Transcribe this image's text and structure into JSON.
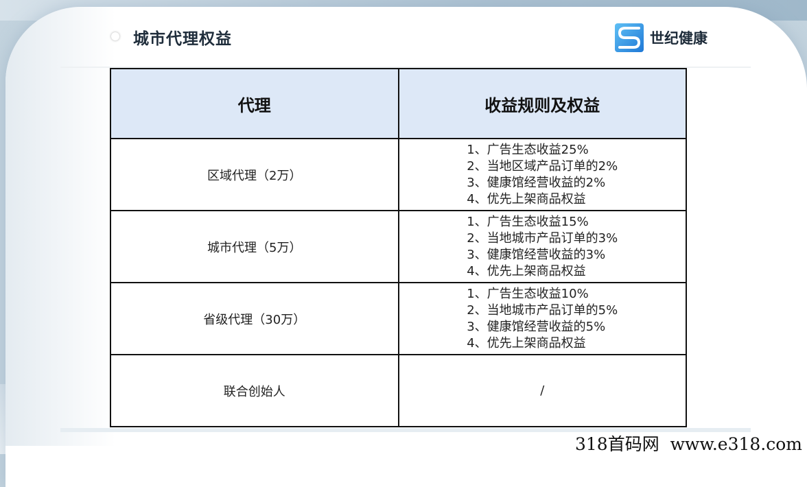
{
  "header": {
    "title": "城市代理权益",
    "brand_name": "世纪健康",
    "brand_icon": "s-letter-logo-icon",
    "brand_color": "#2c92e6"
  },
  "table": {
    "columns": [
      "代理",
      "收益规则及权益"
    ],
    "rows": [
      {
        "agent": "区域代理（2万）",
        "benefits": [
          "1、广告生态收益25%",
          "2、当地区域产品订单的2%",
          "3、健康馆经营收益的2%",
          "4、优先上架商品权益"
        ]
      },
      {
        "agent": "城市代理（5万）",
        "benefits": [
          "1、广告生态收益15%",
          "2、当地城市产品订单的3%",
          "3、健康馆经营收益的3%",
          "4、优先上架商品权益"
        ]
      },
      {
        "agent": "省级代理（30万）",
        "benefits": [
          "1、广告生态收益10%",
          "2、当地城市产品订单的5%",
          "3、健康馆经营收益的5%",
          "4、优先上架商品权益"
        ]
      },
      {
        "agent": "联合创始人",
        "benefits": [
          "/"
        ]
      }
    ]
  },
  "footer": {
    "watermark": "318首码网  www.e318.com"
  }
}
